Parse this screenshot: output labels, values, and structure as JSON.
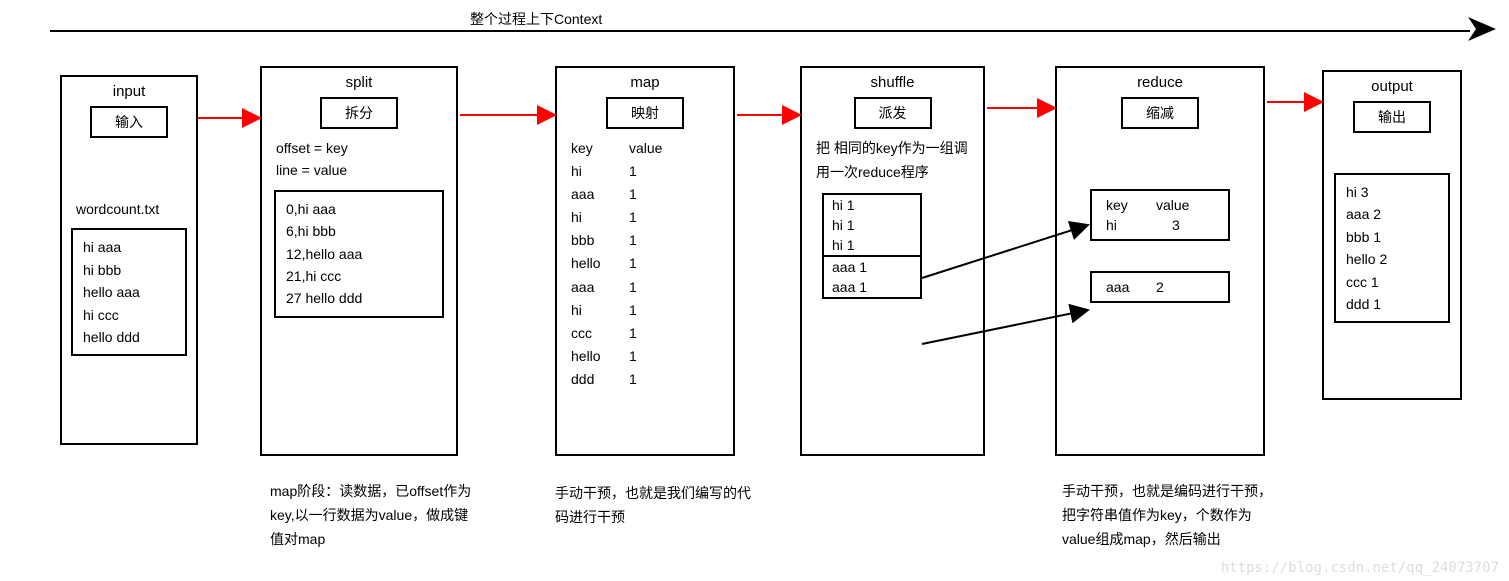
{
  "header": {
    "title": "整个过程上下Context"
  },
  "stages": {
    "input": {
      "title": "input",
      "subtitle": "输入",
      "file_label": "wordcount.txt",
      "file_lines": [
        "hi aaa",
        "hi bbb",
        "hello aaa",
        "hi ccc",
        "hello ddd"
      ]
    },
    "split": {
      "title": "split",
      "subtitle": "拆分",
      "desc1": "offset = key",
      "desc2": "line = value",
      "rows": [
        "0,hi aaa",
        "6,hi bbb",
        "12,hello aaa",
        "21,hi ccc",
        "27 hello ddd"
      ],
      "caption": "map阶段：读数据，已offset作为key,以一行数据为value，做成键值对map"
    },
    "map": {
      "title": "map",
      "subtitle": "映射",
      "header_key": "key",
      "header_val": "value",
      "pairs": [
        {
          "k": "hi",
          "v": "1"
        },
        {
          "k": "aaa",
          "v": "1"
        },
        {
          "k": "hi",
          "v": "1"
        },
        {
          "k": "bbb",
          "v": "1"
        },
        {
          "k": "hello",
          "v": "1"
        },
        {
          "k": "aaa",
          "v": "1"
        },
        {
          "k": "hi",
          "v": "1"
        },
        {
          "k": "ccc",
          "v": "1"
        },
        {
          "k": "hello",
          "v": "1"
        },
        {
          "k": "ddd",
          "v": "1"
        }
      ],
      "caption": "手动干预，也就是我们编写的代码进行干预"
    },
    "shuffle": {
      "title": "shuffle",
      "subtitle": "派发",
      "desc": "把 相同的key作为一组调用一次reduce程序",
      "group1": [
        "hi 1",
        "hi 1",
        "hi 1"
      ],
      "group2": [
        "aaa 1",
        "aaa 1"
      ]
    },
    "reduce": {
      "title": "reduce",
      "subtitle": "缩减",
      "box1_header_k": "key",
      "box1_header_v": "value",
      "box1_row_k": "hi",
      "box1_row_v": "3",
      "box2_k": "aaa",
      "box2_v": "2",
      "caption": "手动干预，也就是编码进行干预，把字符串值作为key，个数作为value组成map，然后输出"
    },
    "output": {
      "title": "output",
      "subtitle": "输出",
      "rows": [
        "hi  3",
        "aaa 2",
        "bbb 1",
        "hello 2",
        "ccc   1",
        "ddd 1"
      ]
    }
  },
  "watermark": "https://blog.csdn.net/qq_24073707"
}
